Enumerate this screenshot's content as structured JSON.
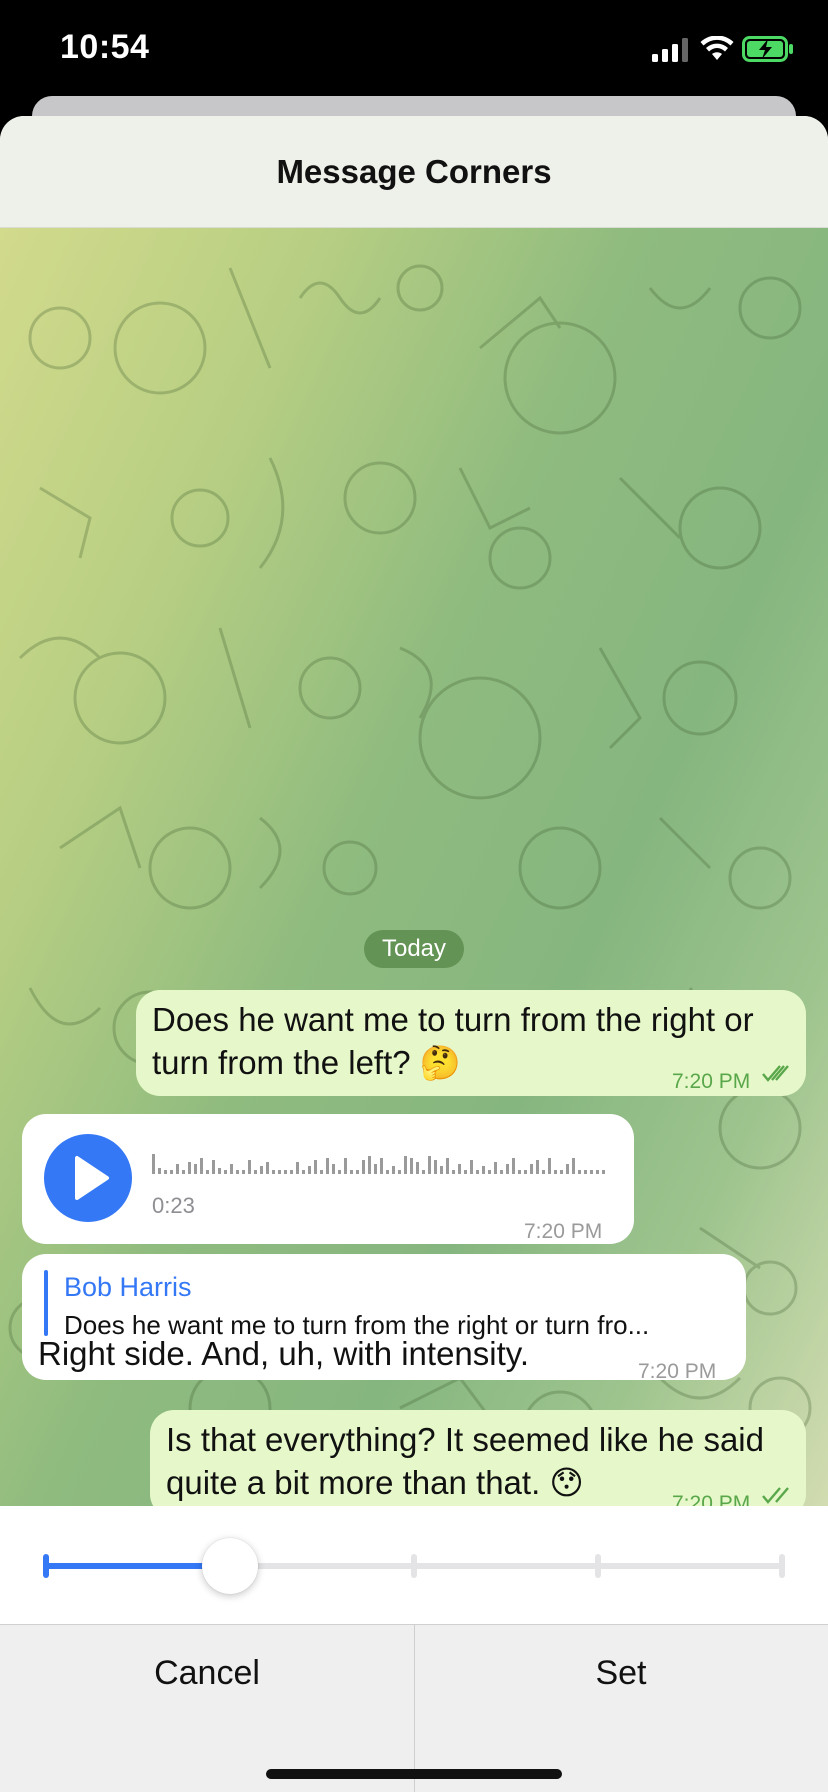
{
  "status_bar": {
    "time": "10:54"
  },
  "sheet": {
    "title": "Message Corners"
  },
  "chat": {
    "date_label": "Today",
    "messages": [
      {
        "kind": "outgoing",
        "text_line1": "Does he want me to turn from the right or",
        "text_line2": "turn from the left? 🤔",
        "time": "7:20 PM"
      },
      {
        "kind": "incoming-voice",
        "duration": "0:23",
        "time": "7:20 PM"
      },
      {
        "kind": "incoming-reply",
        "reply_author": "Bob Harris",
        "reply_text": "Does he want me to turn from the right or turn fro...",
        "text": "Right side. And, uh, with intensity.",
        "time": "7:20 PM"
      },
      {
        "kind": "outgoing",
        "text_line1": "Is that everything? It seemed like he said",
        "text_line2": "quite a bit more than that. 😯",
        "time": "7:20 PM"
      }
    ]
  },
  "slider": {
    "steps": 5,
    "selected_fraction": 0.25
  },
  "buttons": {
    "cancel": "Cancel",
    "set": "Set"
  },
  "colors": {
    "accent": "#3478f6",
    "outgoing_bubble": "#e6f8c9",
    "check_green": "#5aa74b"
  }
}
